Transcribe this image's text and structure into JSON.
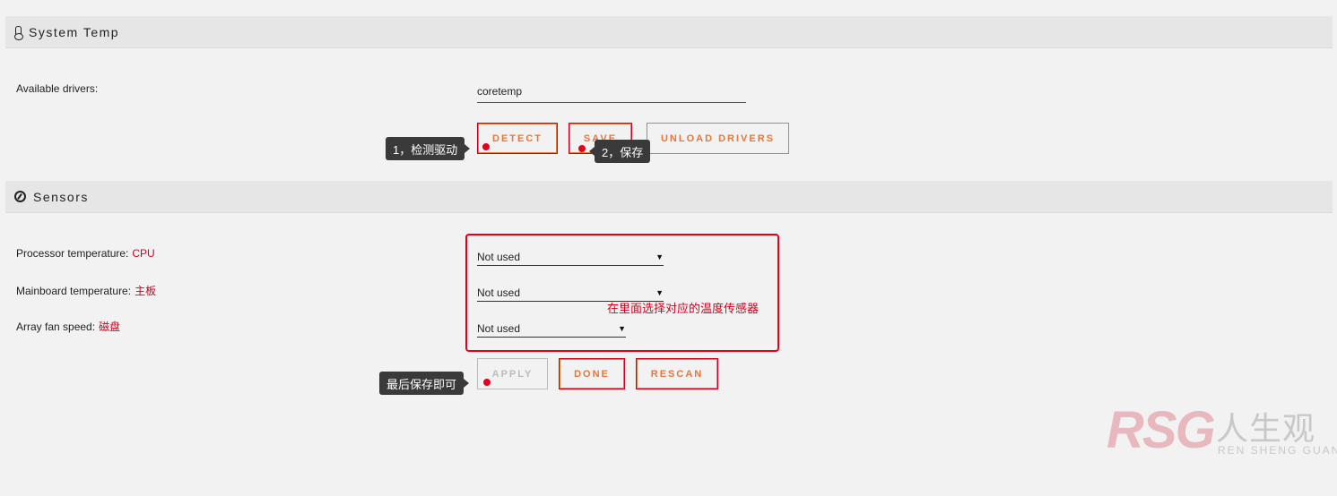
{
  "system_temp": {
    "title": "System Temp",
    "icon": "thermometer-icon",
    "drivers_label": "Available drivers:",
    "drivers_value": "coretemp",
    "buttons": {
      "detect": "DETECT",
      "save": "SAVE",
      "unload": "UNLOAD DRIVERS"
    }
  },
  "sensors": {
    "title": "Sensors",
    "icon": "gauge-icon",
    "rows": [
      {
        "label": "Processor temperature:",
        "note": "CPU",
        "value": "Not used"
      },
      {
        "label": "Mainboard temperature:",
        "note": "主板",
        "value": "Not used"
      },
      {
        "label": "Array fan speed:",
        "note": "磁盘",
        "value": "Not used"
      }
    ],
    "buttons": {
      "apply": "APPLY",
      "done": "DONE",
      "rescan": "RESCAN"
    }
  },
  "annotations": {
    "tip_detect": "1，检测驱动",
    "tip_save": "2，保存",
    "tip_apply": "最后保存即可",
    "box_note": "在里面选择对应的温度传感器",
    "accent_red": "#e3001b",
    "button_orange": "#e8763a"
  },
  "watermark": {
    "logo": "RSG",
    "cn": "人生观",
    "en": "REN SHENG GUAN"
  }
}
